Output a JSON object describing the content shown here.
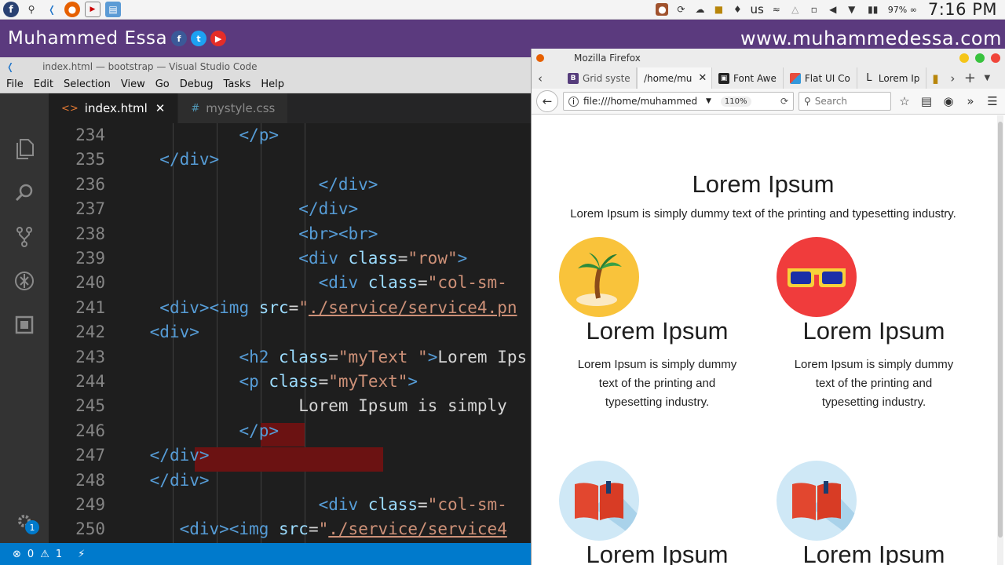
{
  "system_panel": {
    "keyboard_layout": "us",
    "battery": "97% ∞",
    "clock": "7:16 PM"
  },
  "banner": {
    "name": "Muhammed Essa",
    "url": "www.muhammedessa.com",
    "colors": {
      "background": "#5b3a7e",
      "facebook": "#3b5998",
      "twitter": "#1da1f2",
      "youtube": "#e52d27"
    }
  },
  "vscode": {
    "title": "index.html — bootstrap — Visual Studio Code",
    "menu": [
      "File",
      "Edit",
      "Selection",
      "View",
      "Go",
      "Debug",
      "Tasks",
      "Help"
    ],
    "tabs": [
      {
        "label": "index.html",
        "icon": "<>",
        "active": true
      },
      {
        "label": "mystyle.css",
        "icon": "#",
        "active": false
      }
    ],
    "lines": [
      {
        "n": "234",
        "indent": "          ",
        "parts": [
          [
            "tg",
            "</p>"
          ]
        ]
      },
      {
        "n": "235",
        "indent": "  ",
        "parts": [
          [
            "tg",
            "</div>"
          ]
        ]
      },
      {
        "n": "236",
        "indent": "                  ",
        "parts": [
          [
            "tg",
            "</div>"
          ]
        ]
      },
      {
        "n": "237",
        "indent": "                ",
        "parts": [
          [
            "tg",
            "</div>"
          ]
        ]
      },
      {
        "n": "238",
        "indent": "                ",
        "parts": [
          [
            "tg",
            "<br><br>"
          ]
        ]
      },
      {
        "n": "239",
        "indent": "                ",
        "parts": [
          [
            "tg",
            "<div "
          ],
          [
            "at",
            "class"
          ],
          [
            "tx",
            "="
          ],
          [
            "st",
            "\"row\""
          ],
          [
            "tg",
            ">"
          ]
        ]
      },
      {
        "n": "240",
        "indent": "                  ",
        "parts": [
          [
            "tg",
            "<div "
          ],
          [
            "at",
            "class"
          ],
          [
            "tx",
            "="
          ],
          [
            "st",
            "\"col-sm-"
          ]
        ]
      },
      {
        "n": "241",
        "indent": "  ",
        "parts": [
          [
            "tg",
            "<div><img "
          ],
          [
            "at",
            "src"
          ],
          [
            "tx",
            "="
          ],
          [
            "st",
            "\""
          ],
          [
            "su",
            "./service/service4.pn"
          ]
        ]
      },
      {
        "n": "242",
        "indent": " ",
        "parts": [
          [
            "tg",
            "<div>"
          ]
        ]
      },
      {
        "n": "243",
        "indent": "          ",
        "parts": [
          [
            "tg",
            "<h2 "
          ],
          [
            "at",
            "class"
          ],
          [
            "tx",
            "="
          ],
          [
            "st",
            "\"myText \""
          ],
          [
            "tg",
            ">"
          ],
          [
            "tx",
            "Lorem Ips"
          ]
        ]
      },
      {
        "n": "244",
        "indent": "          ",
        "parts": [
          [
            "tg",
            "<p "
          ],
          [
            "at",
            "class"
          ],
          [
            "tx",
            "="
          ],
          [
            "st",
            "\"myText\""
          ],
          [
            "tg",
            ">"
          ]
        ]
      },
      {
        "n": "245",
        "indent": "                ",
        "parts": [
          [
            "tx",
            "Lorem Ipsum is simply"
          ]
        ]
      },
      {
        "n": "246",
        "indent": "          ",
        "parts": [
          [
            "tg",
            "</p>"
          ]
        ]
      },
      {
        "n": "247",
        "indent": " ",
        "parts": [
          [
            "tg",
            "</div>"
          ]
        ]
      },
      {
        "n": "248",
        "indent": " ",
        "parts": [
          [
            "tg",
            "</div>"
          ]
        ]
      },
      {
        "n": "249",
        "indent": "                  ",
        "parts": [
          [
            "tg",
            "<div "
          ],
          [
            "at",
            "class"
          ],
          [
            "tx",
            "="
          ],
          [
            "st",
            "\"col-sm-"
          ]
        ]
      },
      {
        "n": "250",
        "indent": "    ",
        "parts": [
          [
            "tg",
            "<div><img "
          ],
          [
            "at",
            "src"
          ],
          [
            "tx",
            "="
          ],
          [
            "st",
            "\""
          ],
          [
            "su",
            "./service/service4"
          ]
        ]
      }
    ],
    "status": {
      "errors": "0",
      "warnings": "1",
      "settings_badge": "1"
    }
  },
  "firefox": {
    "title": "Mozilla Firefox",
    "tabs": [
      {
        "label": "Grid syste",
        "favicon": "B",
        "fav_color": "#563d7c",
        "active": false
      },
      {
        "label": "/home/mu",
        "favicon": "",
        "fav_color": "",
        "active": true
      },
      {
        "label": "Font Awe",
        "favicon": "▣",
        "fav_color": "#222222",
        "active": false
      },
      {
        "label": "Flat UI Co",
        "favicon": "■",
        "fav_color": "#e74c3c",
        "active": false
      },
      {
        "label": "Lorem Ip",
        "favicon": "L",
        "fav_color": "",
        "active": false
      }
    ],
    "url": "file:///home/muhammed",
    "zoom": "110%",
    "search_placeholder": "Search",
    "page": {
      "heading": "Lorem Ipsum",
      "intro": "Lorem Ipsum is simply dummy text of the printing and typesetting industry.",
      "services": [
        {
          "icon": "palm-tree-icon",
          "title": "Lorem Ipsum",
          "text": "Lorem Ipsum is simply dummy text of the printing and typesetting industry."
        },
        {
          "icon": "sunglasses-icon",
          "title": "Lorem Ipsum",
          "text": "Lorem Ipsum is simply dummy text of the printing and typesetting industry."
        },
        {
          "icon": "book-icon",
          "title": "Lorem Ipsum",
          "text": ""
        },
        {
          "icon": "book-icon",
          "title": "Lorem Ipsum",
          "text": ""
        }
      ]
    }
  }
}
